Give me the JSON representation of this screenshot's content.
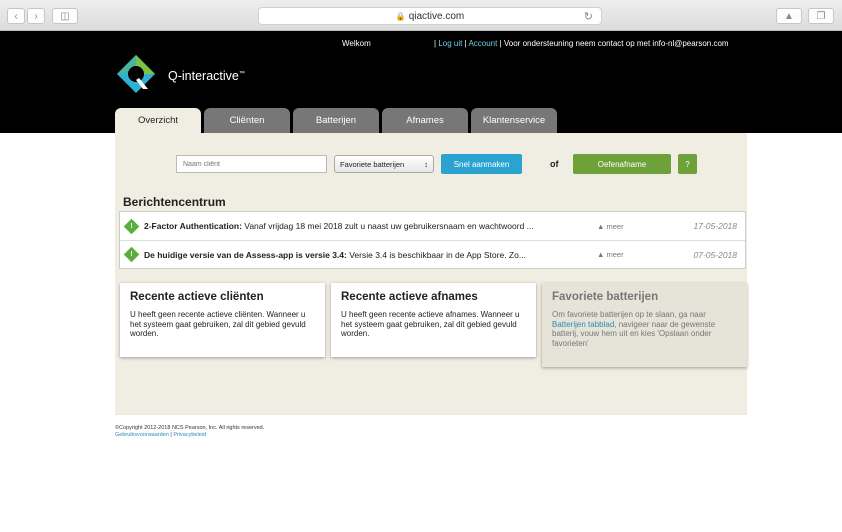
{
  "browser": {
    "url": "qiactive.com",
    "back_icon": "chevron-left-icon",
    "forward_icon": "chevron-right-icon"
  },
  "header": {
    "welcome": "Welkom",
    "logout": "Log uit",
    "account": "Account",
    "support": "Voor ondersteuning neem contact op met info-nl@pearson.com",
    "brand": "Q-interactive",
    "brand_mark": "™"
  },
  "tabs": [
    {
      "label": "Overzicht",
      "active": true
    },
    {
      "label": "Cliënten",
      "active": false
    },
    {
      "label": "Batterijen",
      "active": false
    },
    {
      "label": "Afnames",
      "active": false
    },
    {
      "label": "Klantenservice",
      "active": false
    }
  ],
  "toolbar": {
    "search_placeholder": "Naam cliënt",
    "select_value": "Favoriete batterijen",
    "quick_create": "Snel aanmaken",
    "or": "of",
    "practice": "Oefenafname",
    "help": "?"
  },
  "message_center": {
    "title": "Berichtencentrum",
    "messages": [
      {
        "title": "2-Factor Authentication:",
        "body": " Vanaf vrijdag 18 mei 2018 zult u naast uw gebruikersnaam en wachtwoord ...",
        "more": "meer",
        "date": "17-05-2018"
      },
      {
        "title": "De huidige versie van de Assess-app is versie 3.4:",
        "body": " Versie 3.4 is beschikbaar in de App Store. Zo...",
        "more": "meer",
        "date": "07-05-2018"
      }
    ]
  },
  "cards": {
    "clients": {
      "title": "Recente actieve cliënten",
      "text": "U heeft geen recente actieve cliënten. Wanneer u het systeem gaat gebruiken, zal dit gebied gevuld worden."
    },
    "assessments": {
      "title": "Recente actieve afnames",
      "text": "U heeft geen recente actieve afnames. Wanneer u het systeem gaat gebruiken, zal dit gebied gevuld worden."
    },
    "favorites": {
      "title": "Favoriete batterijen",
      "text_before": "Om favoriete batterijen op te slaan, ga naar ",
      "link": "Batterijen tabblad",
      "text_after": ", navigeer naar de gewenste batterij, vouw hem uit en kies 'Opslaan onder favorieten'"
    }
  },
  "footer": {
    "copyright": "©Copyright 2012-2018 NCS Pearson, Inc. All rights reserved.",
    "terms": "Gebruiksvoorwaarden",
    "separator": "|",
    "privacy": "Privacybeleid"
  },
  "colors": {
    "header_bg": "#000000",
    "content_bg": "#f0ede2",
    "blue_button": "#2aa3d0",
    "green_button": "#6fa13a",
    "link": "#6fd0e8"
  }
}
